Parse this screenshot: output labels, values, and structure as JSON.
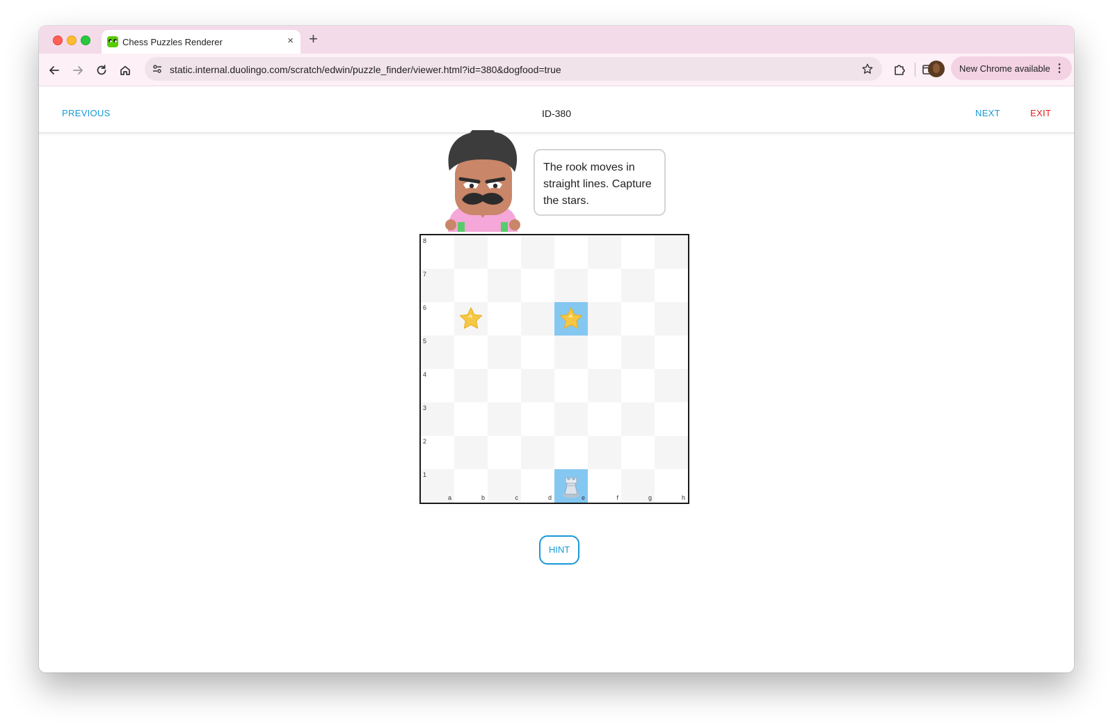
{
  "browser": {
    "tab": {
      "title": "Chess Puzzles Renderer",
      "close_glyph": "×",
      "favicon": "duolingo-owl-icon"
    },
    "new_tab_glyph": "+",
    "url": "static.internal.duolingo.com/scratch/edwin/puzzle_finder/viewer.html?id=380&dogfood=true",
    "update_button": "New Chrome available",
    "menu_glyph": "⋮"
  },
  "header": {
    "previous": "PREVIOUS",
    "puzzle_id": "ID-380",
    "next": "NEXT",
    "exit": "EXIT"
  },
  "speech": {
    "text": "The rook moves in straight lines. Capture the stars."
  },
  "board": {
    "files": [
      "a",
      "b",
      "c",
      "d",
      "e",
      "f",
      "g",
      "h"
    ],
    "ranks": [
      "8",
      "7",
      "6",
      "5",
      "4",
      "3",
      "2",
      "1"
    ],
    "highlighted_squares": [
      "e6",
      "e1"
    ],
    "pieces": [
      {
        "square": "b6",
        "type": "star"
      },
      {
        "square": "e6",
        "type": "star"
      },
      {
        "square": "e1",
        "type": "rook",
        "color": "white"
      }
    ]
  },
  "hint": {
    "label": "HINT"
  },
  "colors": {
    "link_blue": "#1899d6",
    "exit_red": "#e02020",
    "highlight": "#84c8f1",
    "star": "#f6c744"
  }
}
